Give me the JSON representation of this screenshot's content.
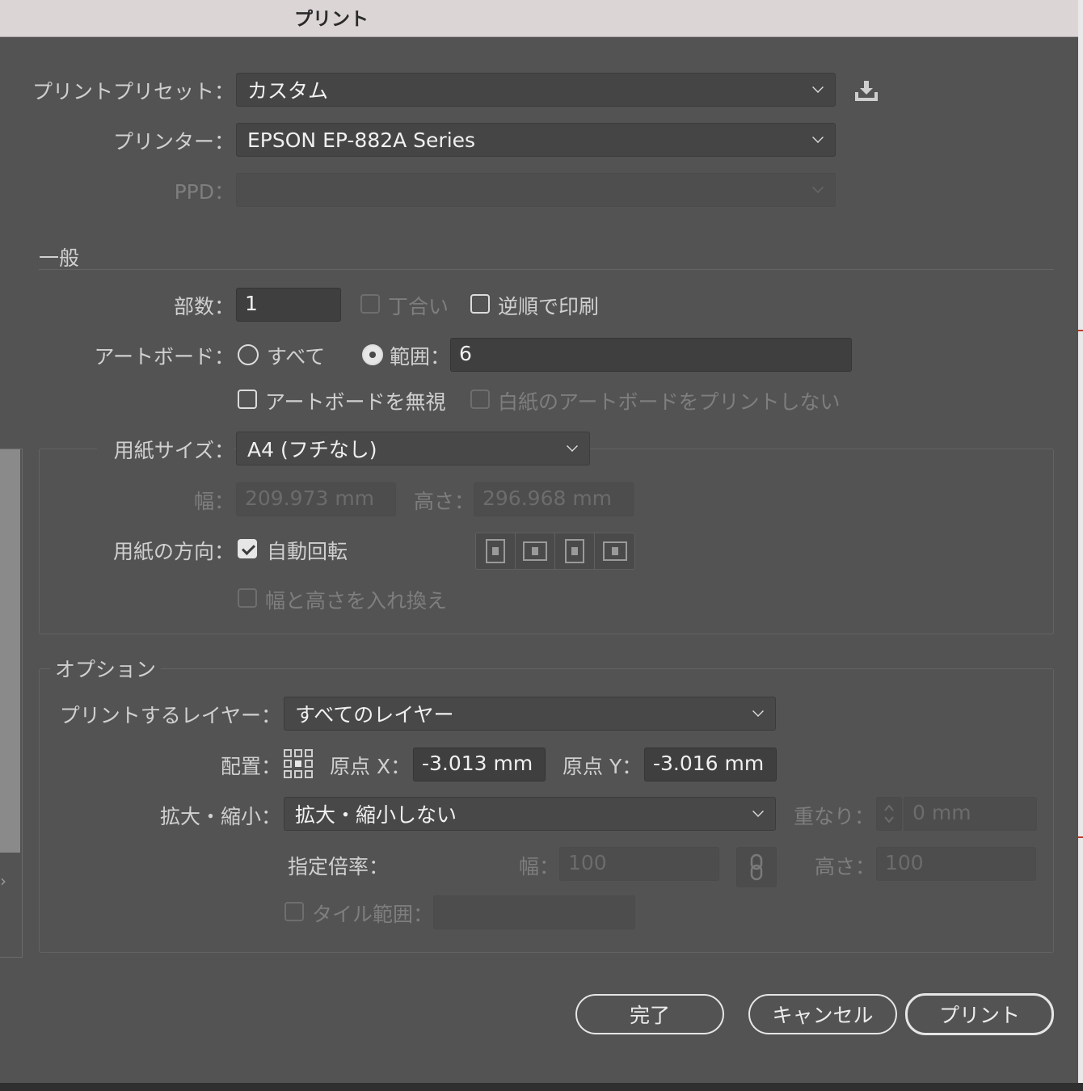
{
  "window": {
    "title": "プリント"
  },
  "preset": {
    "label": "プリントプリセット：",
    "value": "カスタム"
  },
  "printer": {
    "label": "プリンター：",
    "value": "EPSON EP-882A Series"
  },
  "ppd": {
    "label": "PPD：",
    "value": ""
  },
  "general": {
    "heading": "一般",
    "copies_label": "部数：",
    "copies_value": "1",
    "collate_label": "丁合い",
    "reverse_label": "逆順で印刷",
    "artboard_label": "アートボード：",
    "all_label": "すべて",
    "range_label": "範囲：",
    "range_value": "6",
    "ignore_artboards_label": "アートボードを無視",
    "skip_blank_label": "白紙のアートボードをプリントしない"
  },
  "paper": {
    "size_label": "用紙サイズ：",
    "size_value": "A4 (フチなし)",
    "width_label": "幅：",
    "width_value": "209.973 mm",
    "height_label": "高さ：",
    "height_value": "296.968 mm",
    "orientation_label": "用紙の方向：",
    "auto_rotate_label": "自動回転",
    "swap_label": "幅と高さを入れ換え"
  },
  "options": {
    "heading": "オプション",
    "layers_label": "プリントするレイヤー：",
    "layers_value": "すべてのレイヤー",
    "placement_label": "配置：",
    "origin_x_label": "原点 X：",
    "origin_x_value": "-3.013 mm",
    "origin_y_label": "原点 Y：",
    "origin_y_value": "-3.016 mm",
    "scale_label": "拡大・縮小：",
    "scale_value": "拡大・縮小しない",
    "overlap_label": "重なり：",
    "overlap_value": "0 mm",
    "custom_scale_label": "指定倍率：",
    "scale_width_label": "幅：",
    "scale_width_value": "100",
    "scale_height_label": "高さ：",
    "scale_height_value": "100",
    "tile_range_label": "タイル範囲："
  },
  "buttons": {
    "done": "完了",
    "cancel": "キャンセル",
    "print": "プリント"
  },
  "icons": {
    "save_preset": "save-preset-icon",
    "placement": "placement-grid-icon",
    "link": "link-icon",
    "stepper": "stepper-icon"
  }
}
